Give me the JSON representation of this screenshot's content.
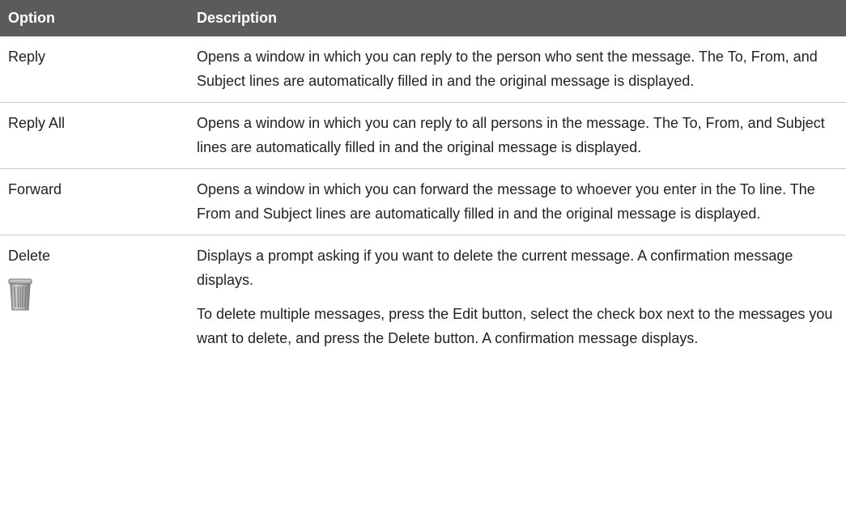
{
  "table": {
    "headers": {
      "option": "Option",
      "description": "Description"
    },
    "rows": [
      {
        "option": "Reply",
        "description": [
          "Opens a window in which you can reply to the person who sent the message. The To, From, and Subject lines are automatically filled in and the original message is displayed."
        ]
      },
      {
        "option": "Reply All",
        "description": [
          "Opens a window in which you can reply to all persons in the message. The To, From, and Subject lines are automatically filled in and the original message is displayed."
        ]
      },
      {
        "option": "Forward",
        "description": [
          "Opens a window in which you can forward the message to whoever you enter in the To line. The From and Subject lines are automatically filled in and the original message is displayed."
        ]
      },
      {
        "option": "Delete",
        "icon": "trash-can-icon",
        "description": [
          "Displays a prompt asking if you want to delete the current message. A confirmation message displays.",
          "To delete multiple messages, press the Edit button, select the check box next to the messages you want to delete, and press the Delete button. A confirmation message displays."
        ]
      }
    ]
  },
  "colors": {
    "header_background": "#5b5b5b",
    "header_text": "#ffffff",
    "row_divider": "#c8c8c8",
    "body_text": "#222222"
  }
}
